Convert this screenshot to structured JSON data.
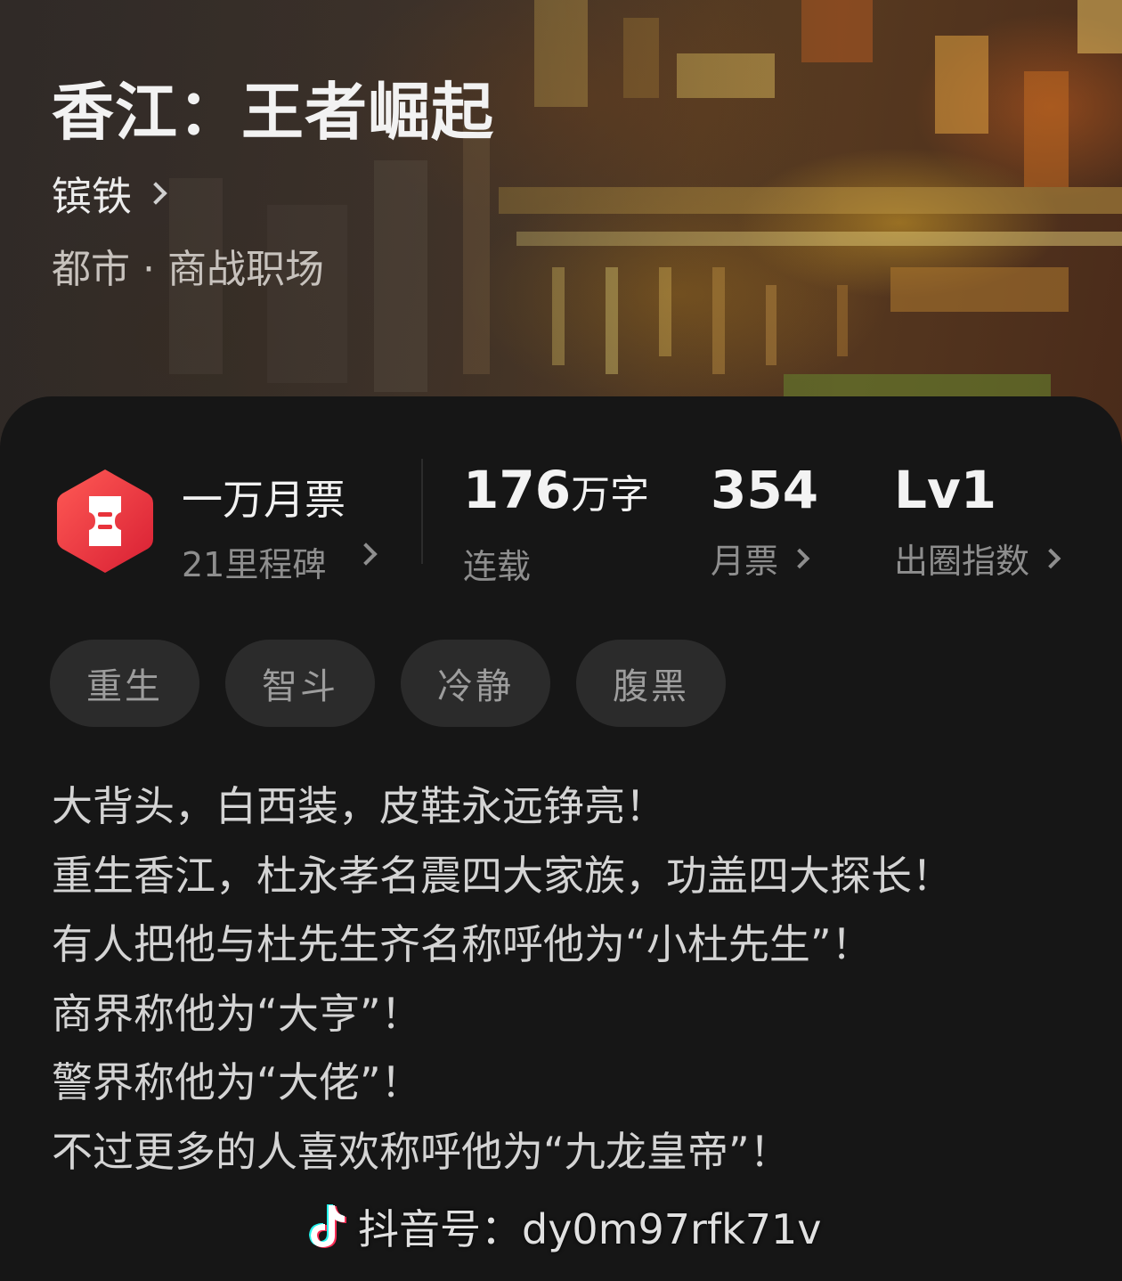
{
  "book": {
    "title": "香江：王者崛起",
    "author": "镔铁",
    "genre": "都市 · 商战职场"
  },
  "stats": {
    "ticket_title": "一万月票",
    "ticket_sub": "21里程碑",
    "words_value": "176",
    "words_unit": "万字",
    "words_label": "连载",
    "monthly_value": "354",
    "monthly_label": "月票",
    "level_value": "Lv1",
    "level_label": "出圈指数"
  },
  "tags": [
    "重生",
    "智斗",
    "冷静",
    "腹黑"
  ],
  "synopsis": [
    "大背头，白西装，皮鞋永远铮亮！",
    "重生香江，杜永孝名震四大家族，功盖四大探长！",
    "有人把他与杜先生齐名称呼他为“小杜先生”！",
    "商界称他为“大亨”！",
    "警界称他为“大佬”！",
    "不过更多的人喜欢称呼他为“九龙皇帝”！"
  ],
  "watermark": {
    "text": "抖音号：dy0m97rfk71v"
  },
  "colors": {
    "background": "#161616",
    "badge_red": "#e8333b",
    "tag_bg": "#2b2b2b"
  },
  "icons": {
    "badge": "ticket-badge-icon",
    "chevron": "chevron-right-icon",
    "watermark_logo": "tiktok-logo-icon"
  }
}
